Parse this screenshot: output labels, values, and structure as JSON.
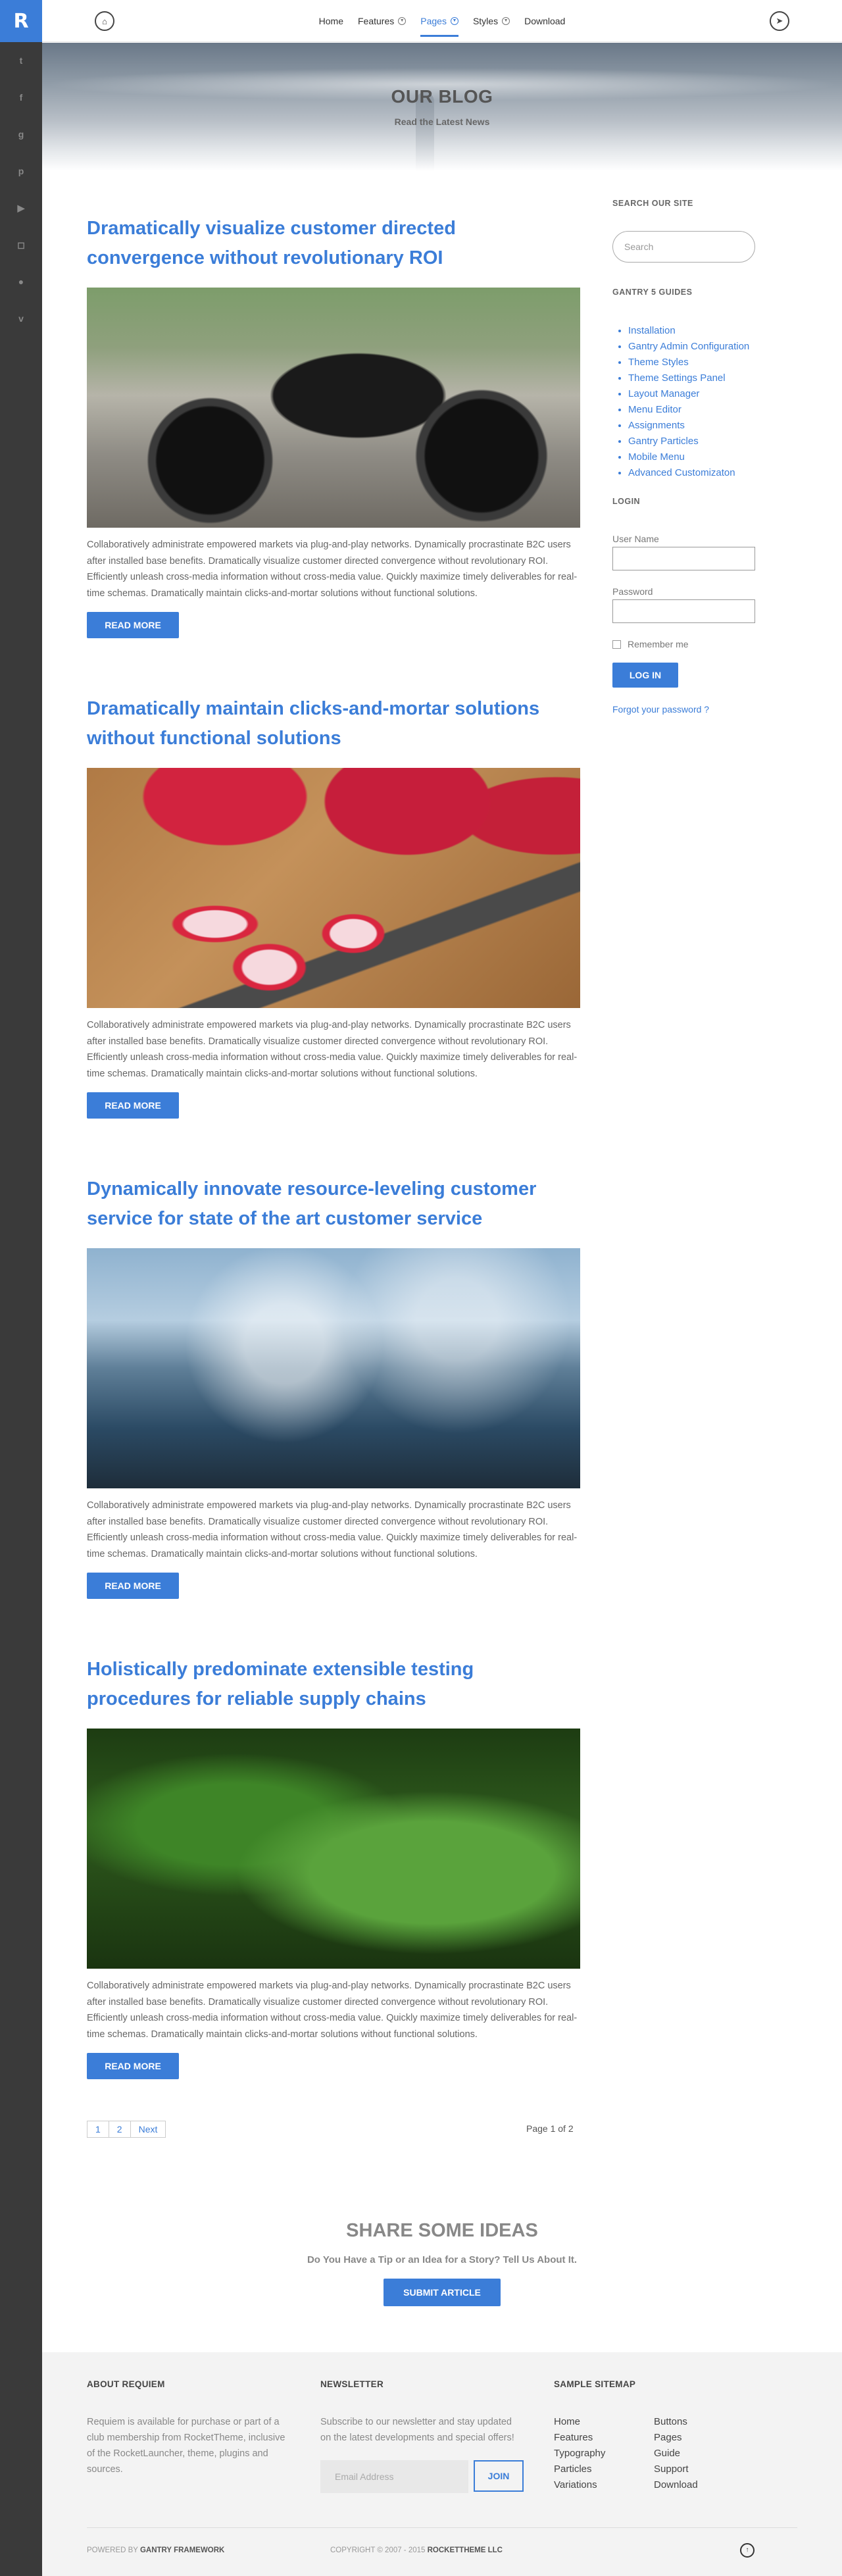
{
  "sidebar": {
    "logo": "R",
    "social": [
      {
        "icon": "twitter-icon",
        "glyph": "t"
      },
      {
        "icon": "facebook-icon",
        "glyph": "f"
      },
      {
        "icon": "google-plus-icon",
        "glyph": "g"
      },
      {
        "icon": "pinterest-icon",
        "glyph": "p"
      },
      {
        "icon": "youtube-icon",
        "glyph": "▶"
      },
      {
        "icon": "instagram-icon",
        "glyph": "◻"
      },
      {
        "icon": "flickr-icon",
        "glyph": "●"
      },
      {
        "icon": "vimeo-icon",
        "glyph": "v"
      }
    ]
  },
  "header": {
    "home_icon": "⌂",
    "nav_icon": "➤",
    "menu": [
      {
        "label": "Home",
        "dropdown": false,
        "active": false
      },
      {
        "label": "Features",
        "dropdown": true,
        "active": false
      },
      {
        "label": "Pages",
        "dropdown": true,
        "active": true
      },
      {
        "label": "Styles",
        "dropdown": true,
        "active": false
      },
      {
        "label": "Download",
        "dropdown": false,
        "active": false
      }
    ]
  },
  "hero": {
    "title": "OUR BLOG",
    "subtitle": "Read the Latest News"
  },
  "posts": [
    {
      "title": "Dramatically visualize customer directed convergence without revolutionary ROI",
      "image": "motorcycle",
      "excerpt": "Collaboratively administrate empowered markets via plug-and-play networks. Dynamically procrastinate B2C users after installed base benefits. Dramatically visualize customer directed convergence without revolutionary ROI. Efficiently unleash cross-media information without cross-media value. Quickly maximize timely deliverables for real-time schemas. Dramatically maintain clicks-and-mortar solutions without functional solutions.",
      "button": "READ MORE"
    },
    {
      "title": "Dramatically maintain clicks-and-mortar solutions without functional solutions",
      "image": "radishes",
      "excerpt": "Collaboratively administrate empowered markets via plug-and-play networks. Dynamically procrastinate B2C users after installed base benefits. Dramatically visualize customer directed convergence without revolutionary ROI. Efficiently unleash cross-media information without cross-media value. Quickly maximize timely deliverables for real-time schemas. Dramatically maintain clicks-and-mortar solutions without functional solutions.",
      "button": "READ MORE"
    },
    {
      "title": "Dynamically innovate resource-leveling customer service for state of the art customer service",
      "image": "water-splash",
      "excerpt": "Collaboratively administrate empowered markets via plug-and-play networks. Dynamically procrastinate B2C users after installed base benefits. Dramatically visualize customer directed convergence without revolutionary ROI. Efficiently unleash cross-media information without cross-media value. Quickly maximize timely deliverables for real-time schemas. Dramatically maintain clicks-and-mortar solutions without functional solutions.",
      "button": "READ MORE"
    },
    {
      "title": "Holistically predominate extensible testing procedures for reliable supply chains",
      "image": "leaves",
      "excerpt": "Collaboratively administrate empowered markets via plug-and-play networks. Dynamically procrastinate B2C users after installed base benefits. Dramatically visualize customer directed convergence without revolutionary ROI. Efficiently unleash cross-media information without cross-media value. Quickly maximize timely deliverables for real-time schemas. Dramatically maintain clicks-and-mortar solutions without functional solutions.",
      "button": "READ MORE"
    }
  ],
  "pagination": {
    "pages": [
      "1",
      "2"
    ],
    "next": "Next",
    "status": "Page 1 of 2"
  },
  "aside": {
    "search_title": "SEARCH OUR SITE",
    "search_placeholder": "Search",
    "guides_title": "GANTRY 5 GUIDES",
    "guides": [
      "Installation",
      "Gantry Admin Configuration",
      "Theme Styles",
      "Theme Settings Panel",
      "Layout Manager",
      "Menu Editor",
      "Assignments",
      "Gantry Particles",
      "Mobile Menu",
      "Advanced Customizaton"
    ],
    "login_title": "LOGIN",
    "username_label": "User Name",
    "password_label": "Password",
    "remember_label": "Remember me",
    "login_button": "LOG IN",
    "forgot_link": "Forgot your password ?"
  },
  "share": {
    "title": "SHARE SOME IDEAS",
    "subtitle": "Do You Have a Tip or an Idea for a Story? Tell Us About It.",
    "button": "SUBMIT ARTICLE"
  },
  "footer": {
    "about_title": "ABOUT REQUIEM",
    "about_text": "Requiem is available for purchase or part of a club membership from RocketTheme, inclusive of the RocketLauncher, theme, plugins and sources.",
    "newsletter_title": "NEWSLETTER",
    "newsletter_text": "Subscribe to our newsletter and stay updated on the latest developments and special offers!",
    "email_placeholder": "Email Address",
    "join_button": "JOIN",
    "sitemap_title": "SAMPLE SITEMAP",
    "sitemap_col1": [
      "Home",
      "Features",
      "Typography",
      "Particles",
      "Variations"
    ],
    "sitemap_col2": [
      "Buttons",
      "Pages",
      "Guide",
      "Support",
      "Download"
    ],
    "powered_prefix": "POWERED BY",
    "powered_name": "GANTRY FRAMEWORK",
    "copyright_prefix": "COPYRIGHT © 2007 - 2015",
    "copyright_name": "ROCKETTHEME LLC",
    "top_icon": "↑"
  },
  "colors": {
    "accent": "#3b7dd8",
    "sidebar": "#3a3a3a",
    "footer_bg": "#f3f3f3"
  }
}
